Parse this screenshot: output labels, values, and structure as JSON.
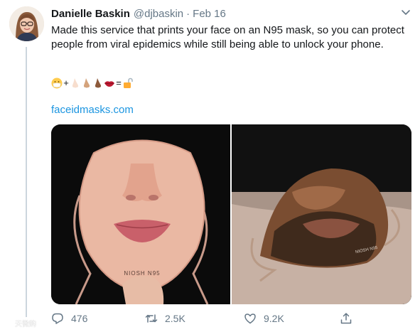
{
  "tweet": {
    "author": {
      "display_name": "Danielle Baskin",
      "handle": "@djbaskin",
      "avatar_icon": "profile-photo"
    },
    "separator": "·",
    "date": "Feb 16",
    "text": "Made this service that prints your face on an N95 mask, so you can protect people from viral epidemics while still being able to unlock your phone.",
    "emoji_equation": {
      "plus": "+",
      "equals": "=",
      "items": [
        "mask-face-emoji",
        "nose-light-emoji",
        "nose-medium-emoji",
        "nose-dark-emoji",
        "lips-emoji",
        "unlocked-padlock-emoji"
      ]
    },
    "link_text": "faceidmasks.com",
    "media": {
      "left": "n95-mask-printed-smiling-face-photo",
      "right": "n95-mask-printed-bearded-face-photo",
      "mask_print": "NIOSH N95"
    },
    "actions": {
      "reply_count": "476",
      "retweet_count": "2.5K",
      "like_count": "9.2K"
    }
  },
  "watermark": {
    "text": "天微购"
  },
  "colors": {
    "text": "#14171a",
    "muted": "#657786",
    "link": "#1b95e0",
    "thread_line": "#ccd6dd"
  }
}
